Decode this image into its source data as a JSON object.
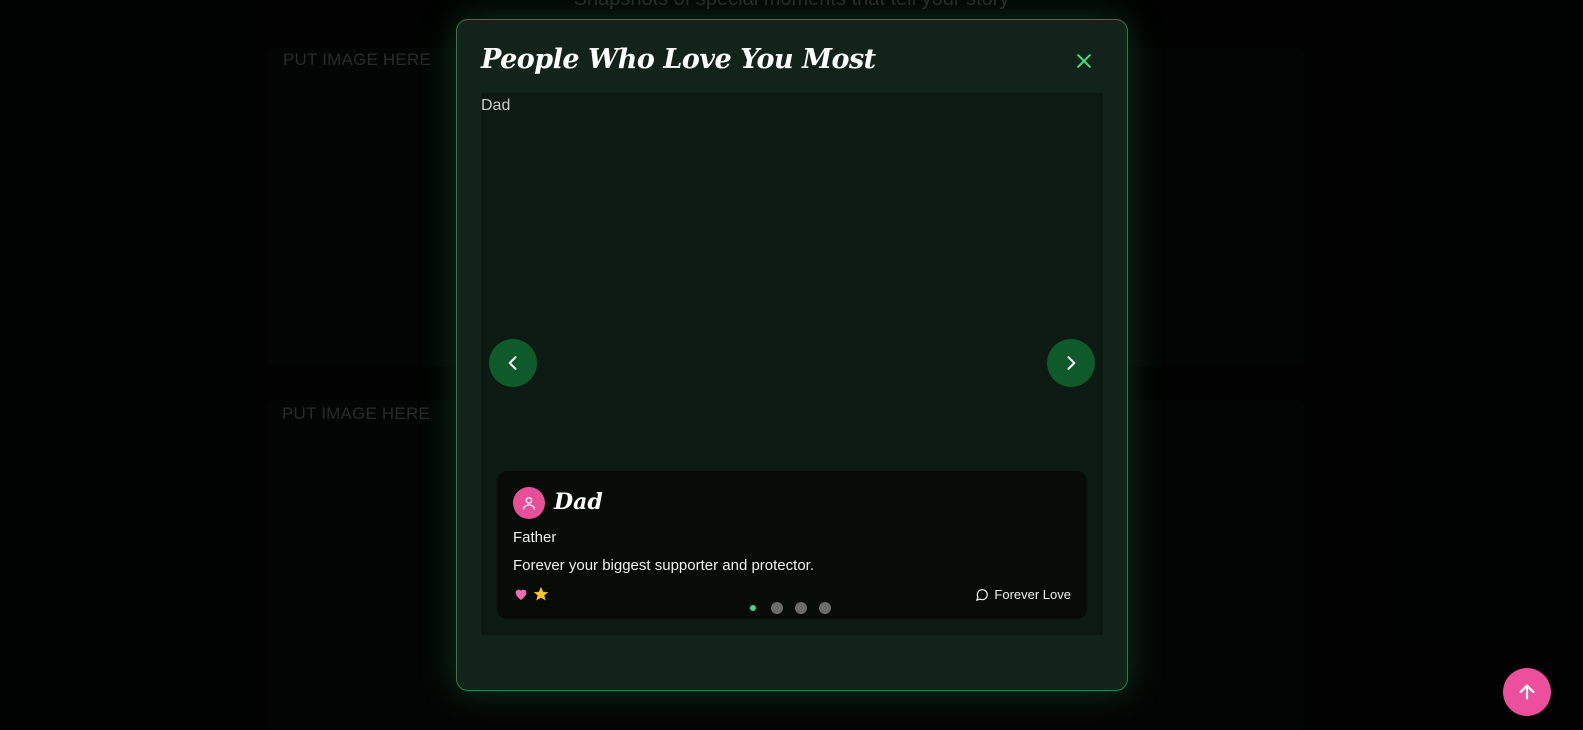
{
  "background": {
    "subtitle": "Snapshots of special moments that tell your story",
    "placeholders": [
      "PUT IMAGE HERE",
      "PUT IMAGE HERE"
    ]
  },
  "modal": {
    "title": "People Who Love You Most",
    "close_icon": "close-icon",
    "slide": {
      "label": "Dad",
      "name": "Dad",
      "relation": "Father",
      "message": "Forever your biggest supporter and protector.",
      "emojis": [
        "heart-icon",
        "star-icon"
      ],
      "tag_label": "Forever Love",
      "tag_icon": "message-circle-icon"
    },
    "dots": {
      "count": 4,
      "active_index": 0
    }
  },
  "colors": {
    "accent_green": "#3ddc84",
    "nav_button": "#0f5a2a",
    "avatar_pink": "#e84f9a",
    "scroll_button": "#ec4f9c"
  }
}
